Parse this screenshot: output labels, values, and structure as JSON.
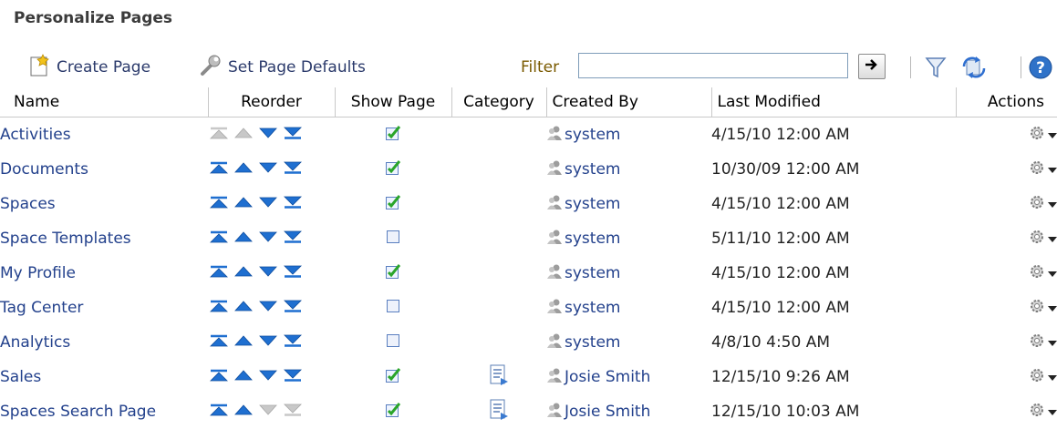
{
  "title": "Personalize Pages",
  "toolbar": {
    "create_label": "Create Page",
    "defaults_label": "Set Page Defaults",
    "filter_label": "Filter",
    "filter_value": ""
  },
  "columns": {
    "name": "Name",
    "reorder": "Reorder",
    "show": "Show Page",
    "category": "Category",
    "created": "Created By",
    "modified": "Last Modified",
    "actions": "Actions"
  },
  "rows": [
    {
      "name": "Activities",
      "show": true,
      "category": false,
      "created": "system",
      "modified": "4/15/10 12:00 AM",
      "up_enabled": false,
      "down_enabled": true
    },
    {
      "name": "Documents",
      "show": true,
      "category": false,
      "created": "system",
      "modified": "10/30/09 12:00 AM",
      "up_enabled": true,
      "down_enabled": true
    },
    {
      "name": "Spaces",
      "show": true,
      "category": false,
      "created": "system",
      "modified": "4/15/10 12:00 AM",
      "up_enabled": true,
      "down_enabled": true
    },
    {
      "name": "Space Templates",
      "show": false,
      "category": false,
      "created": "system",
      "modified": "5/11/10 12:00 AM",
      "up_enabled": true,
      "down_enabled": true
    },
    {
      "name": "My Profile",
      "show": true,
      "category": false,
      "created": "system",
      "modified": "4/15/10 12:00 AM",
      "up_enabled": true,
      "down_enabled": true
    },
    {
      "name": "Tag Center",
      "show": false,
      "category": false,
      "created": "system",
      "modified": "4/15/10 12:00 AM",
      "up_enabled": true,
      "down_enabled": true
    },
    {
      "name": "Analytics",
      "show": false,
      "category": false,
      "created": "system",
      "modified": "4/8/10 4:50 AM",
      "up_enabled": true,
      "down_enabled": true
    },
    {
      "name": "Sales",
      "show": true,
      "category": true,
      "created": "Josie Smith",
      "modified": "12/15/10 9:26 AM",
      "up_enabled": true,
      "down_enabled": true
    },
    {
      "name": "Spaces Search Page",
      "show": true,
      "category": true,
      "created": "Josie Smith",
      "modified": "12/15/10 10:03 AM",
      "up_enabled": true,
      "down_enabled": false
    }
  ],
  "colors": {
    "link": "#23418c",
    "arrow_enabled": "#1f6fd0",
    "arrow_disabled": "#c8c8c8",
    "check_green": "#2aa52a"
  },
  "icons": {
    "create": "create-page-icon",
    "defaults": "wrench-icon",
    "go": "go-arrow-icon",
    "filter": "funnel-icon",
    "refresh": "refresh-icon",
    "help": "help-icon",
    "user": "user-icon",
    "category": "document-icon",
    "actions": "gear-icon"
  }
}
